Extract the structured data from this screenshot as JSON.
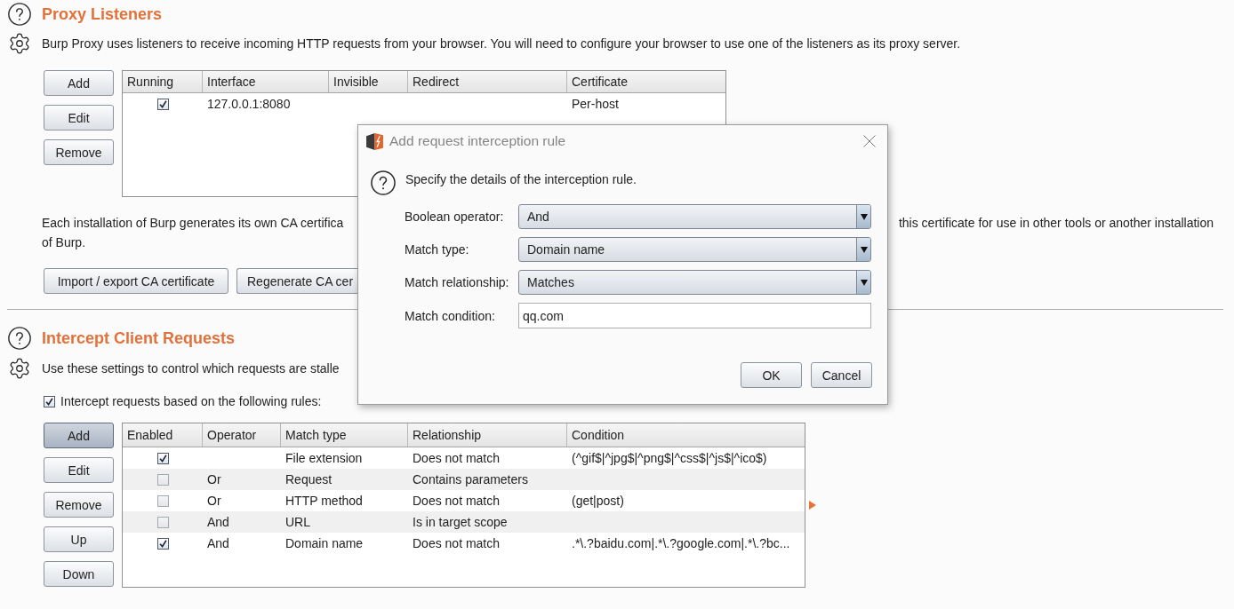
{
  "proxy_listeners": {
    "title": "Proxy Listeners",
    "description": "Burp Proxy uses listeners to receive incoming HTTP requests from your browser. You will need to configure your browser to use one of the listeners as its proxy server.",
    "buttons": [
      {
        "label": "Add"
      },
      {
        "label": "Edit"
      },
      {
        "label": "Remove"
      }
    ],
    "table": {
      "columns": [
        "Running",
        "Interface",
        "Invisible",
        "Redirect",
        "Certificate"
      ],
      "rows": [
        {
          "running": true,
          "interface": "127.0.0.1:8080",
          "certificate": "Per-host"
        }
      ]
    },
    "certificate_note": {
      "line_1_left": "Each installation of Burp generates its own CA certifica",
      "line_1_right": "this certificate for use in other tools or another installation",
      "line_2": "of Burp."
    },
    "certificate_buttons": [
      {
        "label": "Import / export CA certificate"
      },
      {
        "label": "Regenerate CA cer"
      }
    ]
  },
  "intercept_client_requests": {
    "title": "Intercept Client Requests",
    "description": "Use these settings to control which requests are stalle",
    "intercept_rules": {
      "label": "Intercept requests based on the following rules:",
      "checked": true
    },
    "buttons": [
      {
        "label": "Add",
        "pressed": true
      },
      {
        "label": "Edit",
        "pressed": false
      },
      {
        "label": "Remove",
        "pressed": false
      },
      {
        "label": "Up",
        "pressed": false
      },
      {
        "label": "Down",
        "pressed": false
      }
    ],
    "table": {
      "columns": [
        "Enabled",
        "Operator",
        "Match type",
        "Relationship",
        "Condition"
      ],
      "rows": [
        {
          "enabled": true,
          "match_type": "File extension",
          "relationship": "Does not match",
          "condition": "(^gif$|^jpg$|^png$|^css$|^js$|^ico$)"
        },
        {
          "enabled": false,
          "operator": "Or",
          "match_type": "Request",
          "relationship": "Contains parameters"
        },
        {
          "enabled": false,
          "operator": "Or",
          "match_type": "HTTP method",
          "relationship": "Does not match",
          "condition": "(get|post)"
        },
        {
          "enabled": false,
          "operator": "And",
          "match_type": "URL",
          "relationship": "Is in target scope"
        },
        {
          "enabled": true,
          "operator": "And",
          "match_type": "Domain name",
          "relationship": "Does not match",
          "condition": ".*\\.?baidu.com|.*\\.?google.com|.*\\.?bc..."
        }
      ]
    }
  },
  "dialog": {
    "title": "Add request interception rule",
    "prompt": "Specify the details of the interception rule.",
    "fields": [
      {
        "label": "Boolean operator:",
        "kind": "dropdown",
        "value": "And"
      },
      {
        "label": "Match type:",
        "kind": "dropdown",
        "value": "Domain name"
      },
      {
        "label": "Match relationship:",
        "kind": "dropdown",
        "value": "Matches"
      },
      {
        "label": "Match condition:",
        "kind": "text",
        "value": "qq.com"
      }
    ],
    "buttons": [
      {
        "label": "OK"
      },
      {
        "label": "Cancel"
      }
    ]
  }
}
